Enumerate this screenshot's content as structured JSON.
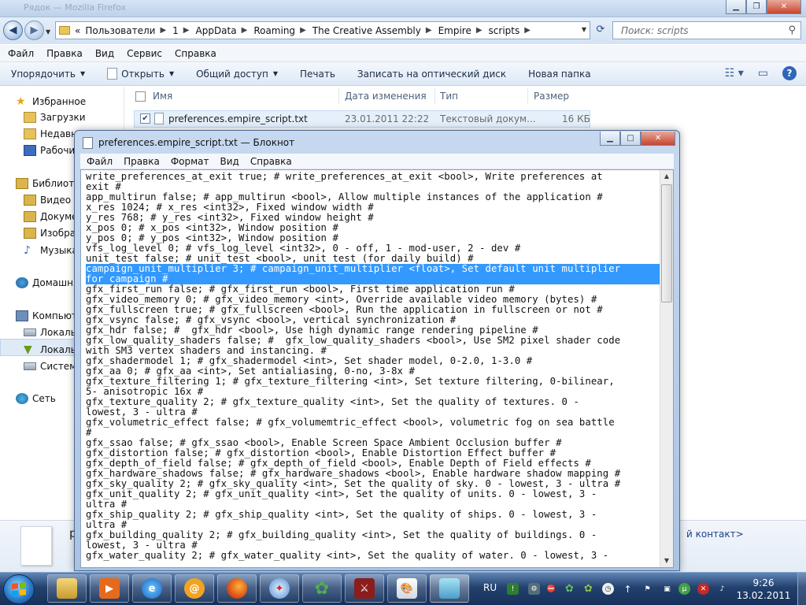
{
  "explorer": {
    "title": "Рядок — Mozilla Firefox",
    "breadcrumbs": [
      "«",
      "Пользователи",
      "1",
      "AppData",
      "Roaming",
      "The Creative Assembly",
      "Empire",
      "scripts"
    ],
    "search_placeholder": "Поиск: scripts",
    "menu": [
      "Файл",
      "Правка",
      "Вид",
      "Сервис",
      "Справка"
    ],
    "commands": {
      "organize": "Упорядочить",
      "open": "Открыть",
      "share": "Общий доступ",
      "print": "Печать",
      "burn": "Записать на оптический диск",
      "new_folder": "Новая папка"
    },
    "nav": {
      "favorites": "Избранное",
      "downloads": "Загрузки",
      "recent": "Недавни",
      "desktop": "Рабочий",
      "libraries": "Библиотек",
      "video": "Видео",
      "documents": "Докуме",
      "images": "Изобра",
      "music": "Музыка",
      "homegroup": "Домашня",
      "computer": "Компьюте",
      "local1": "Локальн",
      "local2": "Локальн",
      "system": "Системн",
      "network": "Сеть"
    },
    "columns": {
      "name": "Имя",
      "date": "Дата изменения",
      "type": "Тип",
      "size": "Размер"
    },
    "file": {
      "name": "preferences.empire_script.txt",
      "date": "23.01.2011 22:22",
      "type": "Текстовый докум...",
      "size": "16 КБ"
    },
    "details": {
      "letter": "р",
      "right": "й контакт>"
    }
  },
  "notepad": {
    "title": "preferences.empire_script.txt — Блокнот",
    "menu": [
      "Файл",
      "Правка",
      "Формат",
      "Вид",
      "Справка"
    ],
    "lines": [
      "write_preferences_at_exit true; # write_preferences_at_exit <bool>, Write preferences at",
      "exit #",
      "app_multirun false; # app_multirun <bool>, Allow multiple instances of the application #",
      "x_res 1024; # x_res <int32>, Fixed window width #",
      "y_res 768; # y_res <int32>, Fixed window height #",
      "x_pos 0; # x_pos <int32>, Window position #",
      "y_pos 0; # y_pos <int32>, Window position #",
      "vfs_log_level 0; # vfs_log_level <int32>, 0 - off, 1 - mod-user, 2 - dev #",
      "unit_test false; # unit_test <bool>, unit test (for daily build) #",
      "campaign_unit_multiplier 3; # campaign_unit_multiplier <float>, Set default unit multiplier",
      "for campaign #",
      "gfx_first_run false; # gfx_first_run <bool>, First time application run #",
      "gfx_video_memory 0; # gfx_video_memory <int>, Override available video memory (bytes) #",
      "gfx_fullscreen true; # gfx_fullscreen <bool>, Run the application in fullscreen or not #",
      "gfx_vsync false; # gfx_vsync <bool>, vertical synchronization #",
      "gfx_hdr false; #  gfx_hdr <bool>, Use high dynamic range rendering pipeline #",
      "gfx_low_quality_shaders false; #  gfx_low_quality_shaders <bool>, Use SM2 pixel shader code",
      "with SM3 vertex shaders and instancing. #",
      "gfx_shadermodel 1; # gfx_shadermodel <int>, Set shader model, 0-2.0, 1-3.0 #",
      "gfx_aa 0; # gfx_aa <int>, Set antialiasing, 0-no, 3-8x #",
      "gfx_texture_filtering 1; # gfx_texture_filtering <int>, Set texture filtering, 0-bilinear,",
      "5- anisotropic 16x #",
      "gfx_texture_quality 2; # gfx_texture_quality <int>, Set the quality of textures. 0 -",
      "lowest, 3 - ultra #",
      "gfx_volumetric_effect false; # gfx_volumemtric_effect <bool>, volumetric fog on sea battle",
      "#",
      "gfx_ssao false; # gfx_ssao <bool>, Enable Screen Space Ambient Occlusion buffer #",
      "gfx_distortion false; # gfx_distortion <bool>, Enable Distortion Effect buffer #",
      "gfx_depth_of_field false; # gfx_depth_of_field <bool>, Enable Depth of Field effects #",
      "gfx_hardware_shadows false; # gfx_hardware_shadows <bool>, Enable hardware shadow mapping #",
      "gfx_sky_quality 2; # gfx_sky_quality <int>, Set the quality of sky. 0 - lowest, 3 - ultra #",
      "gfx_unit_quality 2; # gfx_unit_quality <int>, Set the quality of units. 0 - lowest, 3 -",
      "ultra #",
      "gfx_ship_quality 2; # gfx_ship_quality <int>, Set the quality of ships. 0 - lowest, 3 -",
      "ultra #",
      "gfx_building_quality 2; # gfx_building_quality <int>, Set the quality of buildings. 0 -",
      "lowest, 3 - ultra #",
      "gfx_water_quality 2; # gfx_water_quality <int>, Set the quality of water. 0 - lowest, 3 -"
    ]
  },
  "taskbar": {
    "language": "RU",
    "time": "9:26",
    "date": "13.02.2011"
  }
}
